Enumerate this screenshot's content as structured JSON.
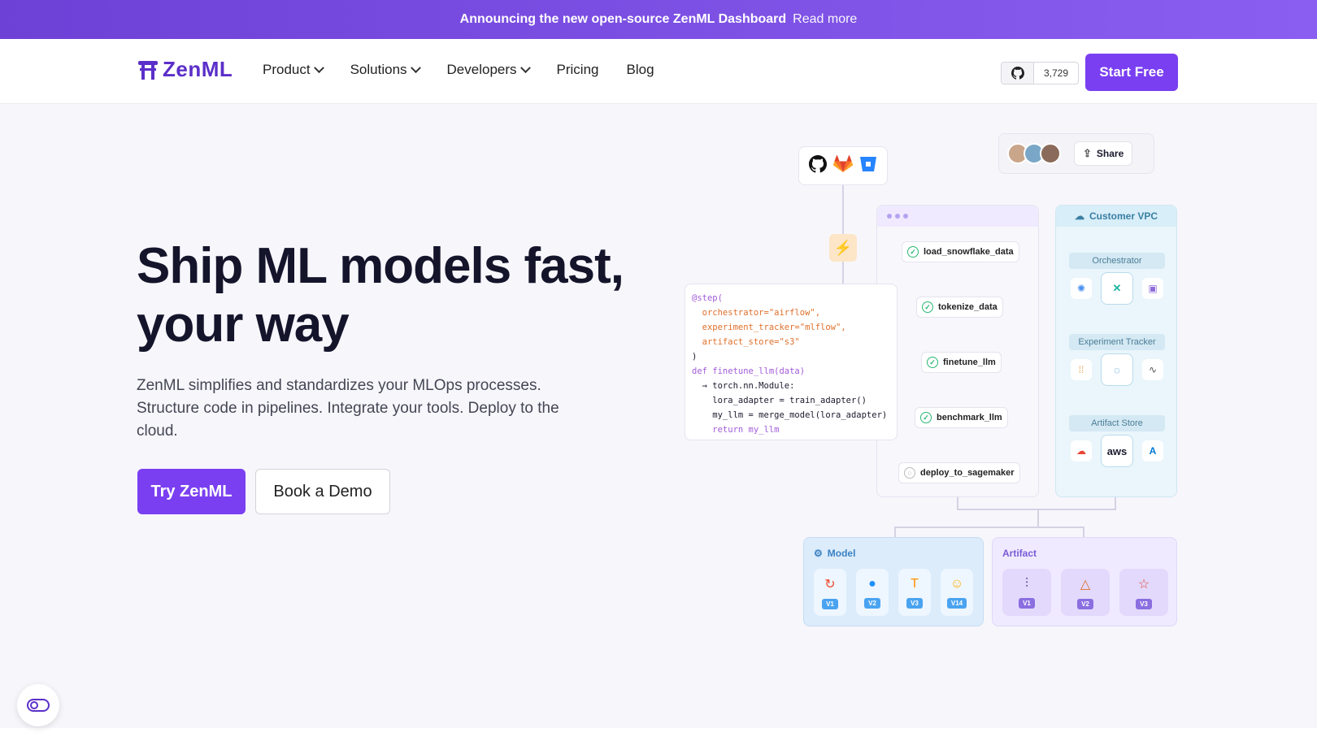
{
  "announcement": {
    "text": "Announcing the new open-source ZenML Dashboard",
    "link": "Read more"
  },
  "nav": {
    "logo": "ZenML",
    "items": [
      {
        "label": "Product",
        "dropdown": true
      },
      {
        "label": "Solutions",
        "dropdown": true
      },
      {
        "label": "Developers",
        "dropdown": true
      },
      {
        "label": "Pricing",
        "dropdown": false
      },
      {
        "label": "Blog",
        "dropdown": false
      }
    ],
    "github_stars": "3,729",
    "cta": "Start Free"
  },
  "hero": {
    "title_line1": "Ship ML models fast,",
    "title_line2": "your way",
    "subtitle": "ZenML simplifies and standardizes your MLOps processes. Structure code in pipelines. Integrate your tools. Deploy to the cloud.",
    "primary_button": "Try ZenML",
    "secondary_button": "Book a Demo"
  },
  "diagram": {
    "share_label": "Share",
    "pipeline_steps": [
      {
        "name": "load_snowflake_data",
        "status": "done"
      },
      {
        "name": "tokenize_data",
        "status": "done"
      },
      {
        "name": "finetune_llm",
        "status": "done"
      },
      {
        "name": "benchmark_llm",
        "status": "done"
      },
      {
        "name": "deploy_to_sagemaker",
        "status": "pending"
      }
    ],
    "code": {
      "l1": "@step(",
      "l2": "  orchestrator=\"airflow\",",
      "l3": "  experiment_tracker=\"mlflow\",",
      "l4": "  artifact_store=\"s3\"",
      "l5": ")",
      "l6": "def finetune_llm(data)",
      "l7": "  → torch.nn.Module:",
      "l8": "    lora_adapter = train_adapter()",
      "l9": "    my_llm = merge_model(lora_adapter)",
      "l10": "    return my_llm"
    },
    "vpc": {
      "title": "Customer VPC",
      "orchestrator": "Orchestrator",
      "experiment_tracker": "Experiment Tracker",
      "artifact_store": "Artifact Store",
      "aws_label": "aws"
    },
    "model": {
      "title": "Model",
      "versions": [
        "V1",
        "V2",
        "V3",
        "V14"
      ]
    },
    "artifact": {
      "title": "Artifact",
      "versions": [
        "V1",
        "V2",
        "V3"
      ]
    }
  }
}
